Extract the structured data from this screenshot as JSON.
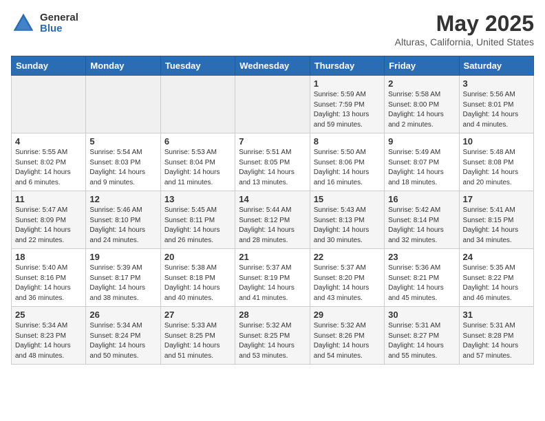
{
  "logo": {
    "general": "General",
    "blue": "Blue"
  },
  "title": "May 2025",
  "location": "Alturas, California, United States",
  "days_of_week": [
    "Sunday",
    "Monday",
    "Tuesday",
    "Wednesday",
    "Thursday",
    "Friday",
    "Saturday"
  ],
  "weeks": [
    [
      {
        "day": "",
        "empty": true
      },
      {
        "day": "",
        "empty": true
      },
      {
        "day": "",
        "empty": true
      },
      {
        "day": "",
        "empty": true
      },
      {
        "day": "1",
        "sunrise": "Sunrise: 5:59 AM",
        "sunset": "Sunset: 7:59 PM",
        "daylight": "Daylight: 13 hours and 59 minutes."
      },
      {
        "day": "2",
        "sunrise": "Sunrise: 5:58 AM",
        "sunset": "Sunset: 8:00 PM",
        "daylight": "Daylight: 14 hours and 2 minutes."
      },
      {
        "day": "3",
        "sunrise": "Sunrise: 5:56 AM",
        "sunset": "Sunset: 8:01 PM",
        "daylight": "Daylight: 14 hours and 4 minutes."
      }
    ],
    [
      {
        "day": "4",
        "sunrise": "Sunrise: 5:55 AM",
        "sunset": "Sunset: 8:02 PM",
        "daylight": "Daylight: 14 hours and 6 minutes."
      },
      {
        "day": "5",
        "sunrise": "Sunrise: 5:54 AM",
        "sunset": "Sunset: 8:03 PM",
        "daylight": "Daylight: 14 hours and 9 minutes."
      },
      {
        "day": "6",
        "sunrise": "Sunrise: 5:53 AM",
        "sunset": "Sunset: 8:04 PM",
        "daylight": "Daylight: 14 hours and 11 minutes."
      },
      {
        "day": "7",
        "sunrise": "Sunrise: 5:51 AM",
        "sunset": "Sunset: 8:05 PM",
        "daylight": "Daylight: 14 hours and 13 minutes."
      },
      {
        "day": "8",
        "sunrise": "Sunrise: 5:50 AM",
        "sunset": "Sunset: 8:06 PM",
        "daylight": "Daylight: 14 hours and 16 minutes."
      },
      {
        "day": "9",
        "sunrise": "Sunrise: 5:49 AM",
        "sunset": "Sunset: 8:07 PM",
        "daylight": "Daylight: 14 hours and 18 minutes."
      },
      {
        "day": "10",
        "sunrise": "Sunrise: 5:48 AM",
        "sunset": "Sunset: 8:08 PM",
        "daylight": "Daylight: 14 hours and 20 minutes."
      }
    ],
    [
      {
        "day": "11",
        "sunrise": "Sunrise: 5:47 AM",
        "sunset": "Sunset: 8:09 PM",
        "daylight": "Daylight: 14 hours and 22 minutes."
      },
      {
        "day": "12",
        "sunrise": "Sunrise: 5:46 AM",
        "sunset": "Sunset: 8:10 PM",
        "daylight": "Daylight: 14 hours and 24 minutes."
      },
      {
        "day": "13",
        "sunrise": "Sunrise: 5:45 AM",
        "sunset": "Sunset: 8:11 PM",
        "daylight": "Daylight: 14 hours and 26 minutes."
      },
      {
        "day": "14",
        "sunrise": "Sunrise: 5:44 AM",
        "sunset": "Sunset: 8:12 PM",
        "daylight": "Daylight: 14 hours and 28 minutes."
      },
      {
        "day": "15",
        "sunrise": "Sunrise: 5:43 AM",
        "sunset": "Sunset: 8:13 PM",
        "daylight": "Daylight: 14 hours and 30 minutes."
      },
      {
        "day": "16",
        "sunrise": "Sunrise: 5:42 AM",
        "sunset": "Sunset: 8:14 PM",
        "daylight": "Daylight: 14 hours and 32 minutes."
      },
      {
        "day": "17",
        "sunrise": "Sunrise: 5:41 AM",
        "sunset": "Sunset: 8:15 PM",
        "daylight": "Daylight: 14 hours and 34 minutes."
      }
    ],
    [
      {
        "day": "18",
        "sunrise": "Sunrise: 5:40 AM",
        "sunset": "Sunset: 8:16 PM",
        "daylight": "Daylight: 14 hours and 36 minutes."
      },
      {
        "day": "19",
        "sunrise": "Sunrise: 5:39 AM",
        "sunset": "Sunset: 8:17 PM",
        "daylight": "Daylight: 14 hours and 38 minutes."
      },
      {
        "day": "20",
        "sunrise": "Sunrise: 5:38 AM",
        "sunset": "Sunset: 8:18 PM",
        "daylight": "Daylight: 14 hours and 40 minutes."
      },
      {
        "day": "21",
        "sunrise": "Sunrise: 5:37 AM",
        "sunset": "Sunset: 8:19 PM",
        "daylight": "Daylight: 14 hours and 41 minutes."
      },
      {
        "day": "22",
        "sunrise": "Sunrise: 5:37 AM",
        "sunset": "Sunset: 8:20 PM",
        "daylight": "Daylight: 14 hours and 43 minutes."
      },
      {
        "day": "23",
        "sunrise": "Sunrise: 5:36 AM",
        "sunset": "Sunset: 8:21 PM",
        "daylight": "Daylight: 14 hours and 45 minutes."
      },
      {
        "day": "24",
        "sunrise": "Sunrise: 5:35 AM",
        "sunset": "Sunset: 8:22 PM",
        "daylight": "Daylight: 14 hours and 46 minutes."
      }
    ],
    [
      {
        "day": "25",
        "sunrise": "Sunrise: 5:34 AM",
        "sunset": "Sunset: 8:23 PM",
        "daylight": "Daylight: 14 hours and 48 minutes."
      },
      {
        "day": "26",
        "sunrise": "Sunrise: 5:34 AM",
        "sunset": "Sunset: 8:24 PM",
        "daylight": "Daylight: 14 hours and 50 minutes."
      },
      {
        "day": "27",
        "sunrise": "Sunrise: 5:33 AM",
        "sunset": "Sunset: 8:25 PM",
        "daylight": "Daylight: 14 hours and 51 minutes."
      },
      {
        "day": "28",
        "sunrise": "Sunrise: 5:32 AM",
        "sunset": "Sunset: 8:25 PM",
        "daylight": "Daylight: 14 hours and 53 minutes."
      },
      {
        "day": "29",
        "sunrise": "Sunrise: 5:32 AM",
        "sunset": "Sunset: 8:26 PM",
        "daylight": "Daylight: 14 hours and 54 minutes."
      },
      {
        "day": "30",
        "sunrise": "Sunrise: 5:31 AM",
        "sunset": "Sunset: 8:27 PM",
        "daylight": "Daylight: 14 hours and 55 minutes."
      },
      {
        "day": "31",
        "sunrise": "Sunrise: 5:31 AM",
        "sunset": "Sunset: 8:28 PM",
        "daylight": "Daylight: 14 hours and 57 minutes."
      }
    ]
  ]
}
